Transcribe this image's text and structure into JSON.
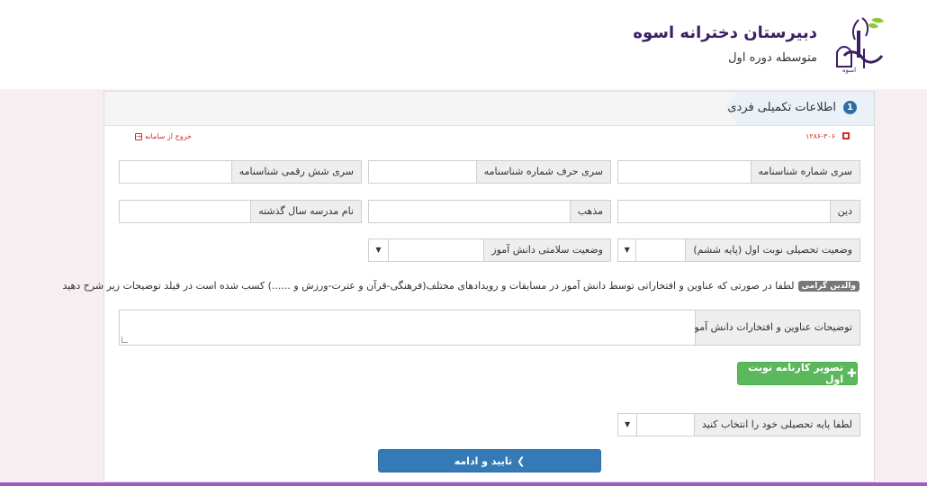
{
  "header": {
    "school_name": "دبیرستان دخترانه اسوه",
    "subtitle": "متوسطه دوره اول",
    "logo_text": "اسوه"
  },
  "panel": {
    "step_number": "1",
    "title": "اطلاعات تکمیلی فردی",
    "code": "۱۲۸۶-۳۰۶",
    "logout_label": "خروج از سامانه"
  },
  "fields": {
    "birth_cert_series": "سری شماره شناسنامه",
    "birth_cert_letter_series": "سری حرف شماره شناسنامه",
    "birth_cert_six_digit": "سری شش رقمی شناسنامه",
    "religion": "دین",
    "sect": "مذهب",
    "previous_school": "نام مدرسه سال گذشته",
    "first_term_status": "وضعیت تحصیلی نوبت اول (پایه ششم)",
    "health_status": "وضعیت سلامتی دانش آموز",
    "honors_description": "توضیحات عناوین و افتخارات دانش آموز",
    "grade_select": "لطفا پایه تحصیلی خود را انتخاب کنید"
  },
  "note": {
    "badge": "والدین گرامی",
    "text": "لطفا در صورتی که عناوین و افتخاراتی توسط دانش آموز در مسابقات و رویدادهای مختلف(فرهنگی-قرآن و عترت-ورزش و ......) کسب شده است در فیلد توضیحات زیر شرح دهید"
  },
  "buttons": {
    "report_card": "تصویر کارنامه نوبت اول",
    "confirm": "تایید و ادامه"
  },
  "colors": {
    "primary": "#337ab7",
    "success": "#5cb85c",
    "title": "#3c1f63",
    "accent_strip": "#a05bc2"
  }
}
